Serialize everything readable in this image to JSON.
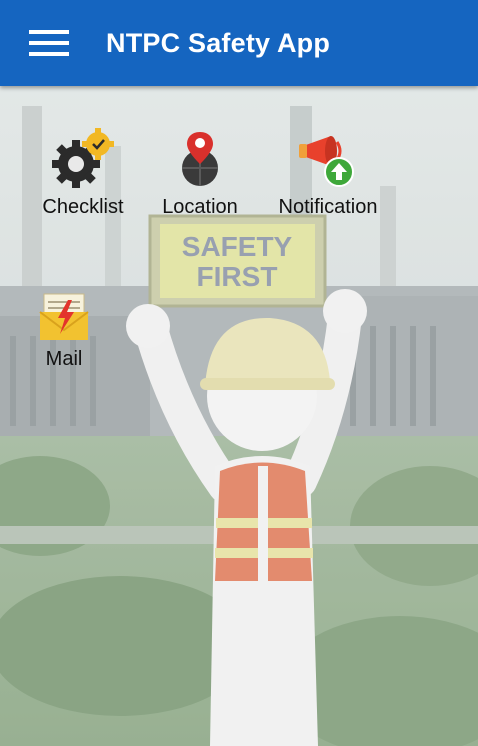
{
  "app_bar": {
    "title": "NTPC Safety App",
    "menu_icon": "hamburger-menu-icon"
  },
  "background": {
    "sign_line1": "SAFETY",
    "sign_line2": "FIRST"
  },
  "tiles": [
    {
      "label": "Checklist",
      "icon": "gear-checklist-icon"
    },
    {
      "label": "Location",
      "icon": "map-pin-icon"
    },
    {
      "label": "Notification",
      "icon": "megaphone-icon"
    },
    {
      "label": "Mail",
      "icon": "mail-envelope-icon"
    }
  ],
  "colors": {
    "app_bar": "#1565c0",
    "title_text": "#ffffff"
  }
}
